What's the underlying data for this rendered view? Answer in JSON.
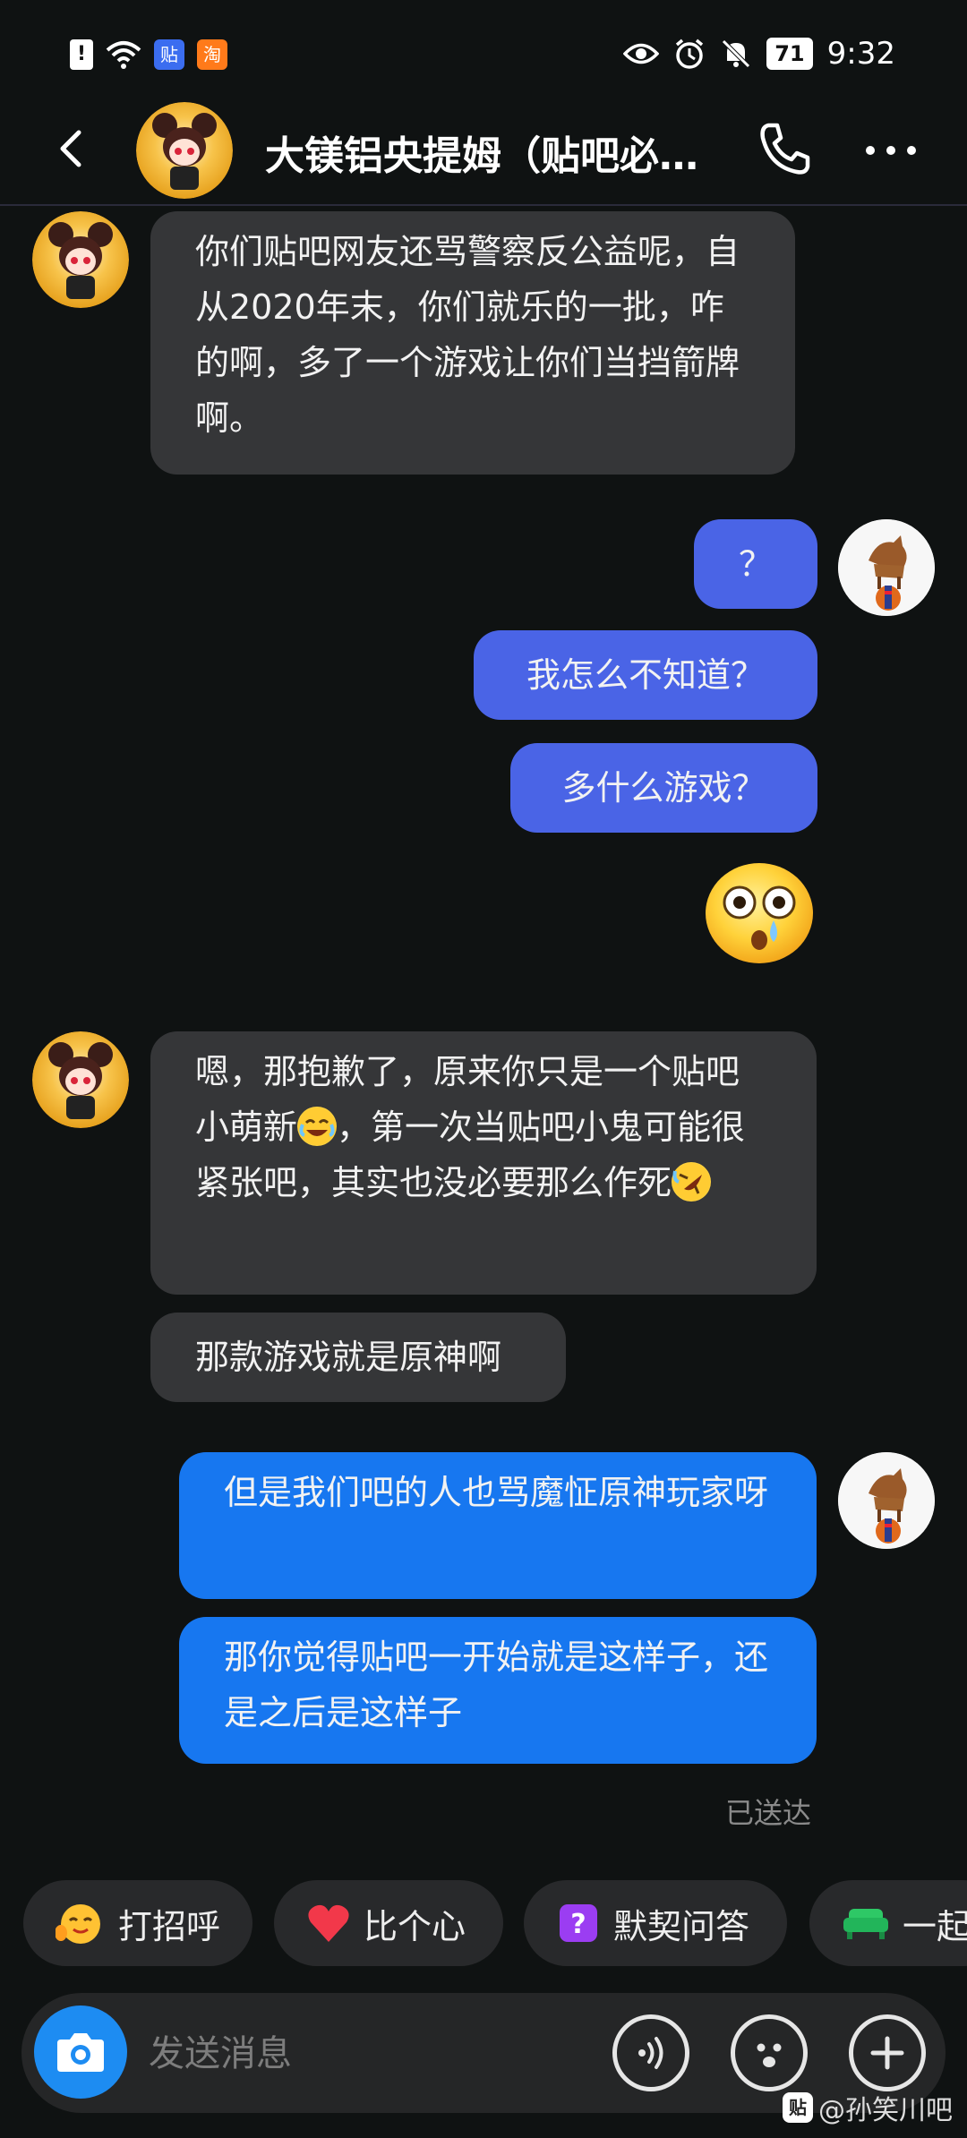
{
  "status_bar": {
    "time": "9:32",
    "battery": "71",
    "notice_icon": "!",
    "app_badge_1": "贴",
    "app_badge_2": "淘"
  },
  "header": {
    "title": "大镁铝央提姆（贴吧必…"
  },
  "messages": [
    {
      "side": "in",
      "text": "你们贴吧网友还骂警察反公益呢，自从2020年末，你们就乐的一批，咋的啊，多了一个游戏让你们当挡箭牌啊。"
    },
    {
      "side": "out",
      "text": "？"
    },
    {
      "side": "out",
      "text": "我怎么不知道？"
    },
    {
      "side": "out",
      "text": "多什么游戏？"
    },
    {
      "side": "in",
      "text_parts": [
        "嗯，那抱歉了，原来你只是一个贴吧小萌新",
        "，第一次当贴吧小鬼可能很紧张吧，其实也没必要那么作死"
      ]
    },
    {
      "side": "in",
      "text": "那款游戏就是原神啊"
    },
    {
      "side": "out",
      "text": "但是我们吧的人也骂魔怔原神玩家呀"
    },
    {
      "side": "out",
      "text": "那你觉得贴吧一开始就是这样子，还是之后是这样子"
    }
  ],
  "delivered_label": "已送达",
  "quick_actions": [
    {
      "label": "打招呼",
      "icon": "wave-emoji-icon"
    },
    {
      "label": "比个心",
      "icon": "heart-icon"
    },
    {
      "label": "默契问答",
      "icon": "question-box-icon"
    },
    {
      "label": "一起",
      "icon": "sofa-icon"
    }
  ],
  "input": {
    "placeholder": "发送消息"
  },
  "watermark": {
    "logo": "贴",
    "text": "@孙笑川吧"
  },
  "colors": {
    "background": "#0f1212",
    "incoming_bubble": "#353638",
    "outgoing_purple": "#4a64e6",
    "outgoing_blue": "#1777f0",
    "camera_button": "#1d8cf2"
  }
}
